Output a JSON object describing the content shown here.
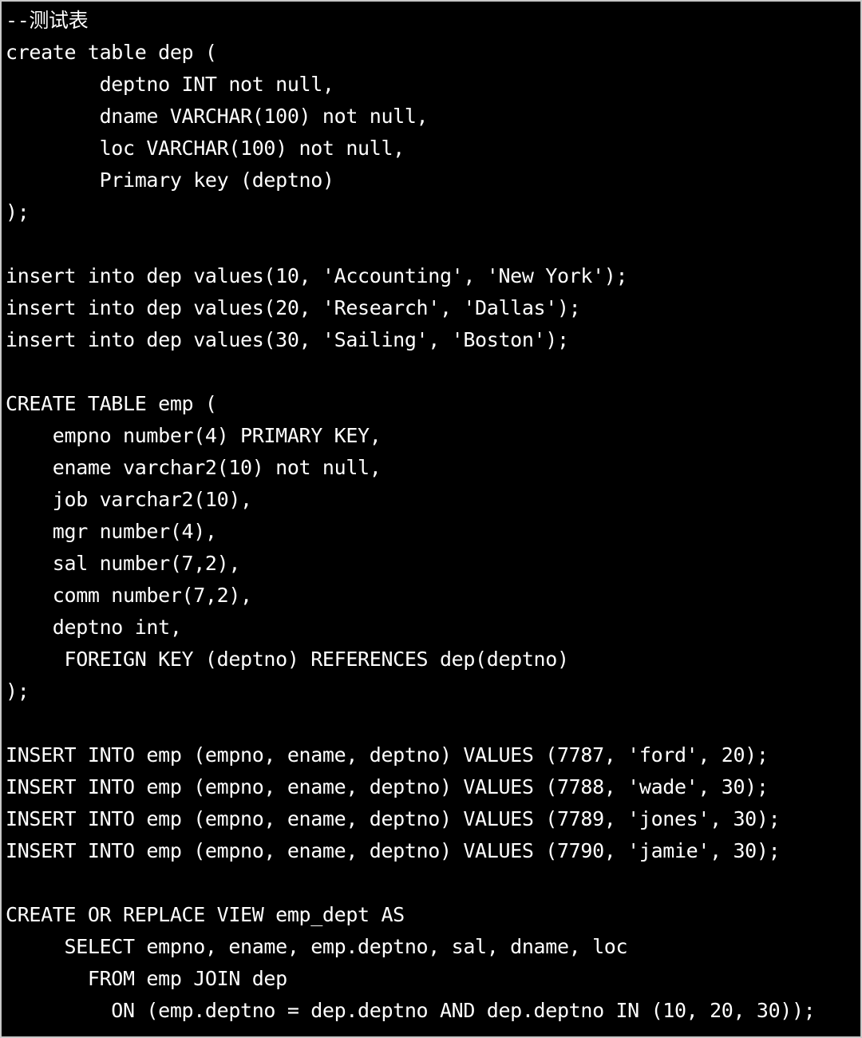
{
  "editor": {
    "language": "sql",
    "background_color": "#000000",
    "text_color": "#ffffff",
    "border_color": "#c8c8c8",
    "font_size_px": 25,
    "line_height_px": 40
  },
  "code": {
    "lines": [
      "--测试表",
      "create table dep (",
      "        deptno INT not null,",
      "        dname VARCHAR(100) not null,",
      "        loc VARCHAR(100) not null,",
      "        Primary key (deptno)",
      ");",
      "",
      "insert into dep values(10, 'Accounting', 'New York');",
      "insert into dep values(20, 'Research', 'Dallas');",
      "insert into dep values(30, 'Sailing', 'Boston');",
      "",
      "CREATE TABLE emp (",
      "    empno number(4) PRIMARY KEY,",
      "    ename varchar2(10) not null,",
      "    job varchar2(10),",
      "    mgr number(4),",
      "    sal number(7,2),",
      "    comm number(7,2),",
      "    deptno int,",
      "     FOREIGN KEY (deptno) REFERENCES dep(deptno)",
      ");",
      "",
      "INSERT INTO emp (empno, ename, deptno) VALUES (7787, 'ford', 20);",
      "INSERT INTO emp (empno, ename, deptno) VALUES (7788, 'wade', 30);",
      "INSERT INTO emp (empno, ename, deptno) VALUES (7789, 'jones', 30);",
      "INSERT INTO emp (empno, ename, deptno) VALUES (7790, 'jamie', 30);",
      "",
      "CREATE OR REPLACE VIEW emp_dept AS",
      "     SELECT empno, ename, emp.deptno, sal, dname, loc",
      "       FROM emp JOIN dep",
      "         ON (emp.deptno = dep.deptno AND dep.deptno IN (10, 20, 30));"
    ]
  },
  "schema": {
    "comment": "--测试表",
    "tables": [
      {
        "name": "dep",
        "columns": [
          {
            "name": "deptno",
            "type": "INT",
            "constraint": "not null"
          },
          {
            "name": "dname",
            "type": "VARCHAR(100)",
            "constraint": "not null"
          },
          {
            "name": "loc",
            "type": "VARCHAR(100)",
            "constraint": "not null"
          }
        ],
        "primary_key": "deptno",
        "rows": [
          {
            "deptno": 10,
            "dname": "Accounting",
            "loc": "New York"
          },
          {
            "deptno": 20,
            "dname": "Research",
            "loc": "Dallas"
          },
          {
            "deptno": 30,
            "dname": "Sailing",
            "loc": "Boston"
          }
        ]
      },
      {
        "name": "emp",
        "columns": [
          {
            "name": "empno",
            "type": "number(4)",
            "constraint": "PRIMARY KEY"
          },
          {
            "name": "ename",
            "type": "varchar2(10)",
            "constraint": "not null"
          },
          {
            "name": "job",
            "type": "varchar2(10)",
            "constraint": ""
          },
          {
            "name": "mgr",
            "type": "number(4)",
            "constraint": ""
          },
          {
            "name": "sal",
            "type": "number(7,2)",
            "constraint": ""
          },
          {
            "name": "comm",
            "type": "number(7,2)",
            "constraint": ""
          },
          {
            "name": "deptno",
            "type": "int",
            "constraint": ""
          }
        ],
        "foreign_key": "FOREIGN KEY (deptno) REFERENCES dep(deptno)",
        "rows": [
          {
            "empno": 7787,
            "ename": "ford",
            "deptno": 20
          },
          {
            "empno": 7788,
            "ename": "wade",
            "deptno": 30
          },
          {
            "empno": 7789,
            "ename": "jones",
            "deptno": 30
          },
          {
            "empno": 7790,
            "ename": "jamie",
            "deptno": 30
          }
        ]
      }
    ],
    "views": [
      {
        "name": "emp_dept",
        "select": "empno, ename, emp.deptno, sal, dname, loc",
        "from": "emp JOIN dep",
        "on": "(emp.deptno = dep.deptno AND dep.deptno IN (10, 20, 30))"
      }
    ]
  }
}
